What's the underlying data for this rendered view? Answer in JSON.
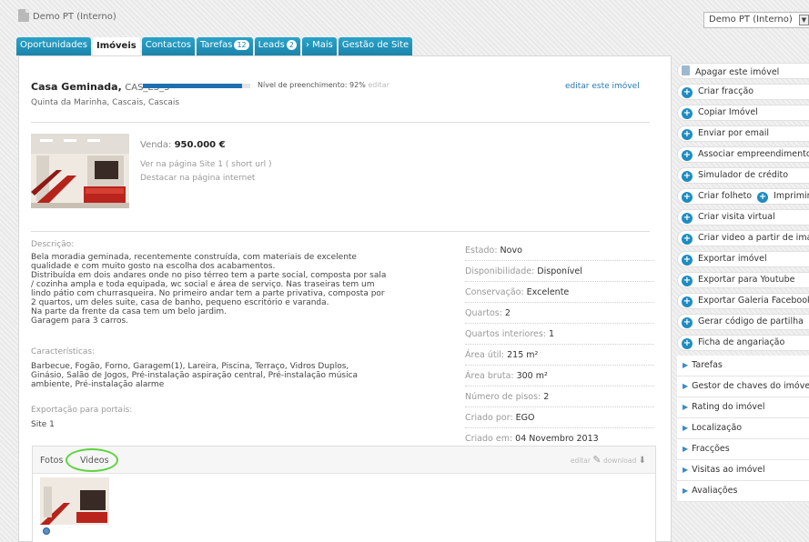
{
  "topbar": {
    "title": "Demo PT (Interno)",
    "account": "Demo PT (Interno)"
  },
  "tabs": [
    {
      "label": "Oportunidades"
    },
    {
      "label": "Imóveis",
      "active": true
    },
    {
      "label": "Contactos"
    },
    {
      "label": "Tarefas",
      "badge": "12"
    },
    {
      "label": "Leads",
      "badge": "2"
    },
    {
      "label": "› Mais"
    },
    {
      "label": "Gestão de Site"
    }
  ],
  "property": {
    "name": "Casa Geminada,",
    "code": "CAS_ES_3",
    "fill_percent": 92,
    "fill_label": "Nível de preenchimento: 92%",
    "fill_edit": "editar",
    "edit_link": "editar este imóvel",
    "address": "Quinta da Marinha, Cascais, Cascais",
    "sale_label": "Venda:",
    "sale_price": "950.000 €",
    "site_link": "Ver na página Site 1 ( short url )",
    "highlight_link": "Destacar na página internet"
  },
  "description": {
    "label": "Descrição:",
    "lines": [
      "Bela moradia geminada, recentemente construída, com materiais de excelente",
      "qualidade e com muito gosto na escolha dos acabamentos.",
      "Distribuída em dois andares onde no piso térreo tem a parte social, composta por sala",
      "/ cozinha ampla e toda equipada, wc social e área de serviço. Nas traseiras tem um",
      "lindo pátio com churrasqueira. No primeiro andar tem a parte privativa, composta por",
      "2 quartos, um deles suite, casa de banho, pequeno escritório e varanda.",
      "Na parte da frente da casa tem um belo jardim.",
      "Garagem para 3 carros."
    ]
  },
  "features": {
    "label": "Características:",
    "lines": [
      "Barbecue, Fogão, Forno, Garagem(1), Lareira, Piscina, Terraço, Vidros Duplos,",
      "Ginásio, Salão de Jogos, Pré-instalação aspiração central, Pré-instalação música",
      "ambiente, Pré-instalação alarme"
    ]
  },
  "export": {
    "label": "Exportação para portais:",
    "value": "Site 1"
  },
  "attributes": [
    {
      "label": "Estado:",
      "value": "Novo"
    },
    {
      "label": "Disponibilidade:",
      "value": "Disponível"
    },
    {
      "label": "Conservação:",
      "value": "Excelente"
    },
    {
      "label": "Quartos:",
      "value": "2"
    },
    {
      "label": "Quartos interiores:",
      "value": "1"
    },
    {
      "label": "Área útil:",
      "value": "215 m²"
    },
    {
      "label": "Área bruta:",
      "value": "300 m²"
    },
    {
      "label": "Número de pisos:",
      "value": "2"
    },
    {
      "label": "Criado por:",
      "value": "EGO"
    },
    {
      "label": "Criado em:",
      "value": "04 Novembro 2013"
    }
  ],
  "media": {
    "tab_photos": "Fotos",
    "tab_videos": "Videos",
    "edit": "editar",
    "download": "download"
  },
  "sidebar": {
    "actions": [
      {
        "label": "Apagar este imóvel",
        "icon": "trash-icon"
      },
      {
        "label": "Criar fracção",
        "icon": "plus-icon"
      },
      {
        "label": "Copiar Imóvel",
        "icon": "plus-icon"
      },
      {
        "label": "Enviar por email",
        "icon": "plus-icon"
      },
      {
        "label": "Associar empreendimento",
        "icon": "plus-icon"
      },
      {
        "label": "Simulador de crédito",
        "icon": "plus-icon"
      },
      {
        "label": "Criar folheto",
        "icon": "plus-icon",
        "extra": "Imprimir"
      },
      {
        "label": "Criar visita virtual",
        "icon": "plus-icon"
      },
      {
        "label": "Criar video a partir de imagens",
        "icon": "plus-icon"
      },
      {
        "label": "Exportar imóvel",
        "icon": "plus-icon"
      },
      {
        "label": "Exportar para Youtube",
        "icon": "plus-icon"
      },
      {
        "label": "Exportar Galeria Facebook",
        "icon": "plus-icon"
      },
      {
        "label": "Gerar código de partilha",
        "icon": "plus-icon"
      },
      {
        "label": "Ficha de angariação",
        "icon": "plus-icon"
      }
    ],
    "sections": [
      {
        "label": "Tarefas"
      },
      {
        "label": "Gestor de chaves do imóvel"
      },
      {
        "label": "Rating do imóvel"
      },
      {
        "label": "Localização"
      },
      {
        "label": "Fracções"
      },
      {
        "label": "Visitas ao imóvel"
      },
      {
        "label": "Avaliações"
      }
    ]
  }
}
